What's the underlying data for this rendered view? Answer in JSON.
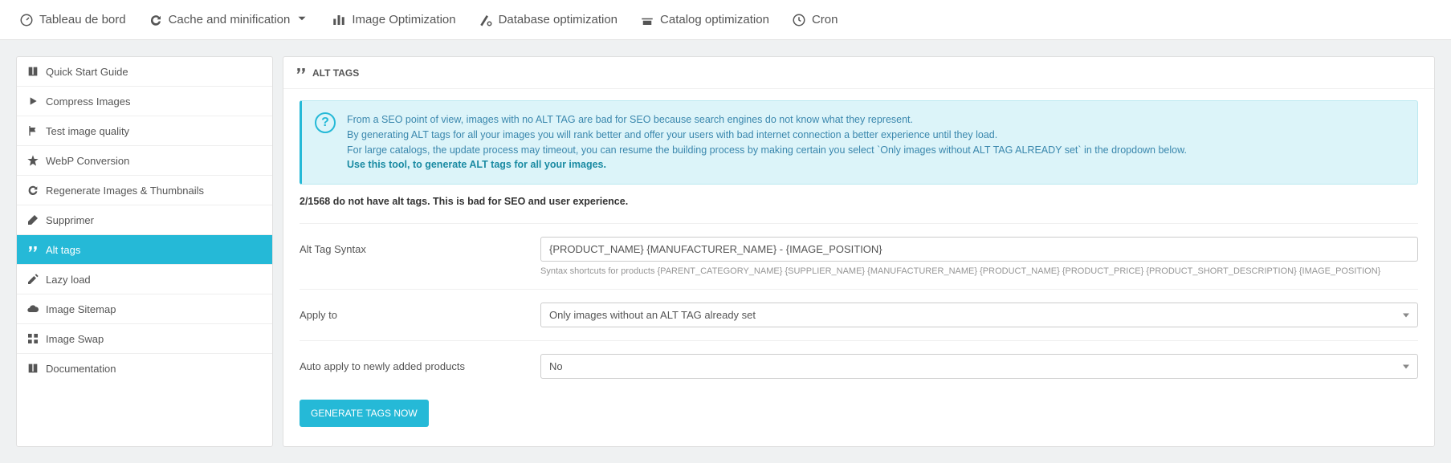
{
  "topnav": [
    {
      "label": "Tableau de bord",
      "icon": "gauge",
      "dropdown": false
    },
    {
      "label": "Cache and minification",
      "icon": "refresh",
      "dropdown": true
    },
    {
      "label": "Image Optimization",
      "icon": "bars",
      "dropdown": false
    },
    {
      "label": "Database optimization",
      "icon": "dbtool",
      "dropdown": false
    },
    {
      "label": "Catalog optimization",
      "icon": "store",
      "dropdown": false
    },
    {
      "label": "Cron",
      "icon": "clock",
      "dropdown": false
    }
  ],
  "sidebar": [
    {
      "label": "Quick Start Guide",
      "icon": "book"
    },
    {
      "label": "Compress Images",
      "icon": "play"
    },
    {
      "label": "Test image quality",
      "icon": "flag"
    },
    {
      "label": "WebP Conversion",
      "icon": "star"
    },
    {
      "label": "Regenerate Images & Thumbnails",
      "icon": "refresh"
    },
    {
      "label": "Supprimer",
      "icon": "eraser"
    },
    {
      "label": "Alt tags",
      "icon": "quote",
      "active": true
    },
    {
      "label": "Lazy load",
      "icon": "pencil"
    },
    {
      "label": "Image Sitemap",
      "icon": "cloud"
    },
    {
      "label": "Image Swap",
      "icon": "grid"
    },
    {
      "label": "Documentation",
      "icon": "book"
    }
  ],
  "panel": {
    "title": "ALT TAGS",
    "alert": {
      "line1": "From a SEO point of view, images with no ALT TAG are bad for SEO because search engines do not know what they represent.",
      "line2": "By generating ALT tags for all your images you will rank better and offer your users with bad internet connection a better experience until they load.",
      "line3": "For large catalogs, the update process may timeout, you can resume the building process by making certain you select `Only images without ALT TAG ALREADY set` in the dropdown below.",
      "line4": "Use this tool, to generate ALT tags for all your images."
    },
    "status": "2/1568 do not have alt tags. This is bad for SEO and user experience.",
    "form": {
      "syntax_label": "Alt Tag Syntax",
      "syntax_value": "{PRODUCT_NAME} {MANUFACTURER_NAME} - {IMAGE_POSITION}",
      "syntax_hint": "Syntax shortcuts for products {PARENT_CATEGORY_NAME} {SUPPLIER_NAME} {MANUFACTURER_NAME} {PRODUCT_NAME} {PRODUCT_PRICE} {PRODUCT_SHORT_DESCRIPTION} {IMAGE_POSITION}",
      "apply_label": "Apply to",
      "apply_value": "Only images without an ALT TAG already set",
      "auto_label": "Auto apply to newly added products",
      "auto_value": "No",
      "button": "GENERATE TAGS NOW"
    }
  }
}
